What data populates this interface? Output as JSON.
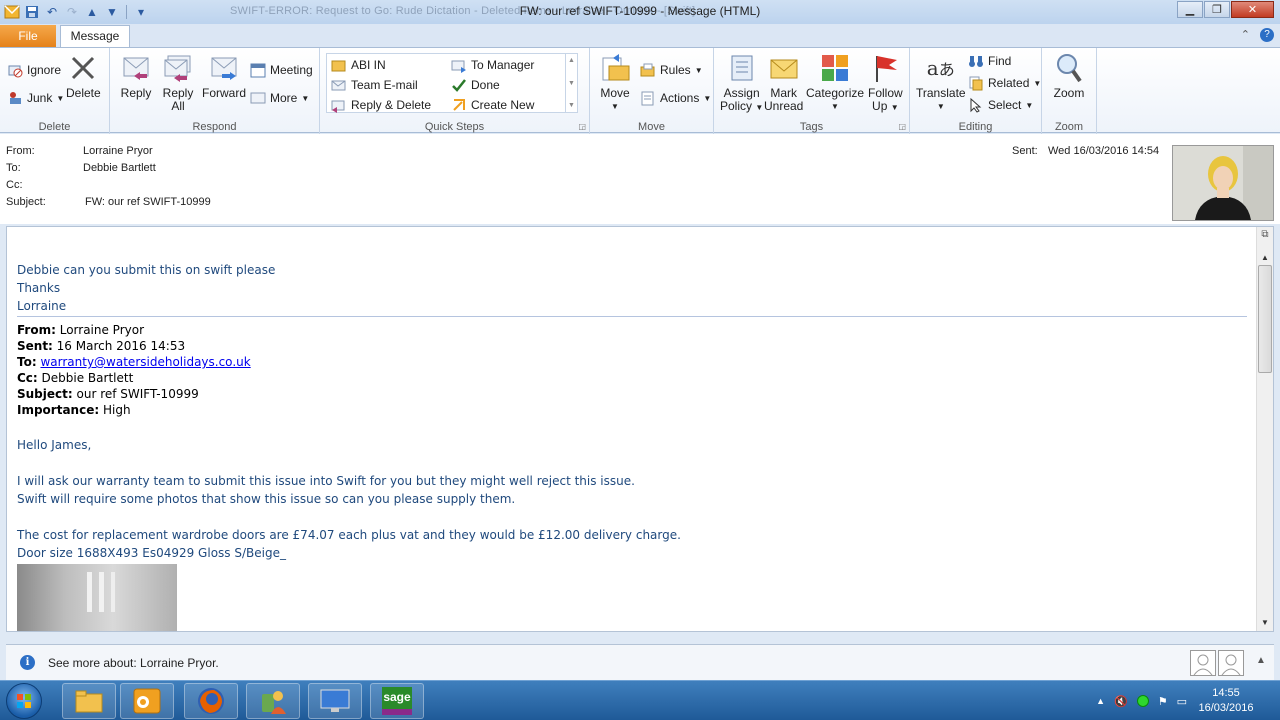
{
  "window": {
    "title": "FW: our ref SWIFT-10999  -  Message (HTML)",
    "background_title": "SWIFT-ERROR: Request to Go: Rude Dictation - Deleted Items - Lorraine - Outlook - [Swift]"
  },
  "tabs": {
    "file": "File",
    "message": "Message"
  },
  "ribbon": {
    "delete_group": {
      "label": "Delete",
      "ignore": "Ignore",
      "junk": "Junk",
      "delete": "Delete"
    },
    "respond_group": {
      "label": "Respond",
      "reply": "Reply",
      "reply_all_1": "Reply",
      "reply_all_2": "All",
      "forward": "Forward",
      "meeting": "Meeting",
      "more": "More"
    },
    "quick_steps_group": {
      "label": "Quick Steps",
      "items": [
        "ABI IN",
        "To Manager",
        "Team E-mail",
        "Done",
        "Reply & Delete",
        "Create New"
      ]
    },
    "move_group": {
      "label": "Move",
      "move": "Move",
      "rules": "Rules",
      "actions": "Actions"
    },
    "tags_group": {
      "label": "Tags",
      "assign_policy_1": "Assign",
      "assign_policy_2": "Policy",
      "mark_unread_1": "Mark",
      "mark_unread_2": "Unread",
      "categorize": "Categorize",
      "follow_up_1": "Follow",
      "follow_up_2": "Up"
    },
    "editing_group": {
      "label": "Editing",
      "translate": "Translate",
      "find": "Find",
      "related": "Related",
      "select": "Select"
    },
    "zoom_group": {
      "label": "Zoom",
      "zoom": "Zoom"
    }
  },
  "header": {
    "from_label": "From:",
    "from_value": "Lorraine Pryor",
    "to_label": "To:",
    "to_value": "Debbie Bartlett",
    "cc_label": "Cc:",
    "cc_value": "",
    "subject_label": "Subject:",
    "subject_value": "FW: our ref SWIFT-10999",
    "sent_label": "Sent:",
    "sent_value": "Wed 16/03/2016 14:54"
  },
  "body": {
    "line1": "Debbie can you submit this on swift please",
    "line2": "Thanks",
    "line3": "Lorraine",
    "fwd": {
      "from_label": "From:",
      "from_value": " Lorraine Pryor",
      "sent_label": "Sent:",
      "sent_value": " 16 March 2016 14:53",
      "to_label": "To:",
      "to_value": "warranty@watersideholidays.co.uk",
      "cc_label": "Cc:",
      "cc_value": " Debbie Bartlett",
      "subject_label": "Subject:",
      "subject_value": " our ref SWIFT-10999",
      "importance_label": "Importance:",
      "importance_value": " High"
    },
    "greeting": "Hello James,",
    "para1_line1": "I will ask our warranty team to submit this issue into Swift for you but they might well reject this issue.",
    "para1_line2": "Swift will require some photos that show this issue so can you please supply them.",
    "para2_line1": "The cost for replacement wardrobe doors are £74.07 each plus vat and they would be £12.00 delivery charge.",
    "para2_line2": "Door size  1688X493 Es04929 Gloss S/Beige_"
  },
  "people_pane": {
    "text": "See more about: Lorraine Pryor."
  },
  "taskbar": {
    "time": "14:55",
    "date": "16/03/2016",
    "sage_label": "sage"
  },
  "colors": {
    "body_text": "#1f497d",
    "file_tab": "#e5821a",
    "taskbar": "#1f5a98"
  }
}
